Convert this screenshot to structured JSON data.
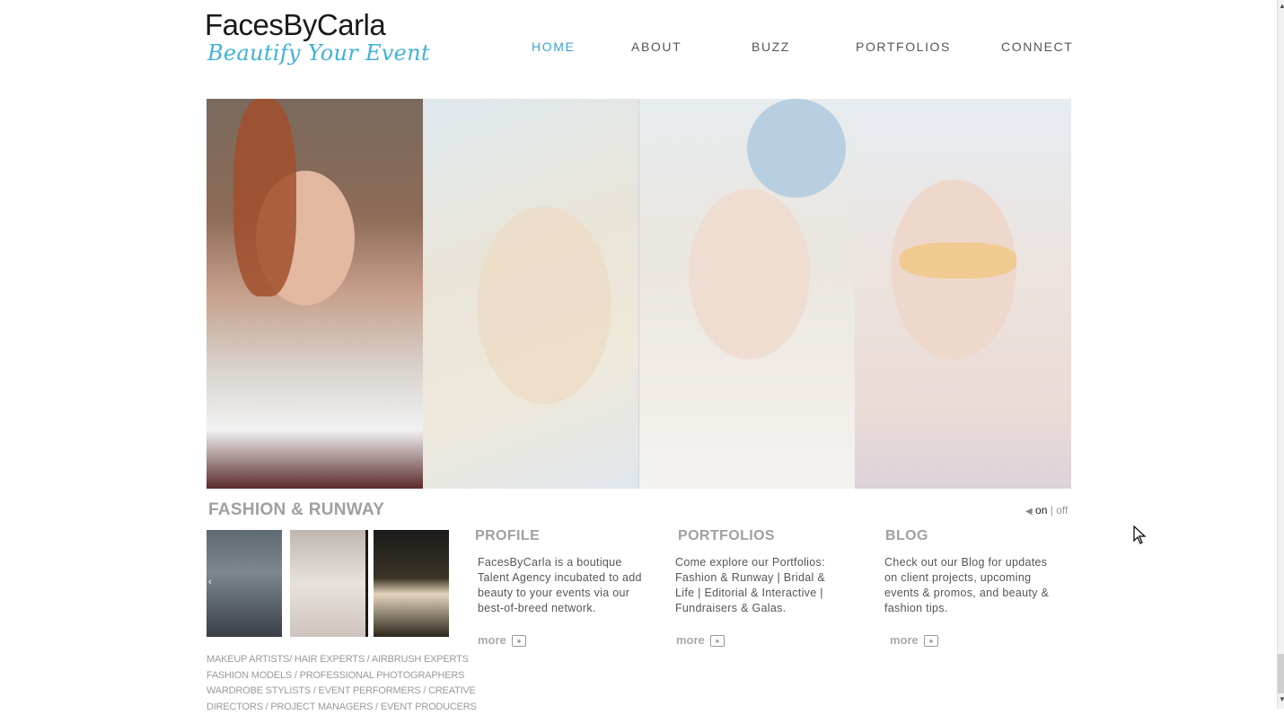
{
  "logo": {
    "title": "FacesByCarla",
    "tagline": "Beautify Your Event"
  },
  "nav": {
    "items": [
      {
        "label": "HOME",
        "active": true
      },
      {
        "label": "ABOUT",
        "active": false
      },
      {
        "label": "BUZZ",
        "active": false
      },
      {
        "label": "PORTFOLIOS",
        "active": false
      },
      {
        "label": "CONNECT",
        "active": false
      }
    ]
  },
  "hero": {
    "section_title": "FASHION & RUNWAY"
  },
  "sound": {
    "on": "on",
    "separator": "|",
    "off": "off"
  },
  "thumbs": {
    "prev": "‹"
  },
  "tags": [
    "MAKEUP ARTISTS/ HAIR EXPERTS / AIRBRUSH EXPERTS",
    "FASHION MODELS / PROFESSIONAL PHOTOGRAPHERS",
    "WARDROBE STYLISTS / EVENT PERFORMERS / CREATIVE",
    "DIRECTORS / PROJECT MANAGERS / EVENT PRODUCERS"
  ],
  "columns": [
    {
      "title": "PROFILE",
      "body": "FacesByCarla is a boutique Talent Agency incubated to add beauty to your events via our best-of-breed network.",
      "more": "more"
    },
    {
      "title": "PORTFOLIOS",
      "body": "Come explore our Portfolios: Fashion & Runway | Bridal & Life | Editorial & Interactive | Fundraisers & Galas.",
      "more": "more"
    },
    {
      "title": "BLOG",
      "body": "Check out our Blog for updates on client projects, upcoming events & promos, and beauty & fashion tips.",
      "more": "more"
    }
  ],
  "colors": {
    "accent": "#3fa3d6",
    "tagline": "#3fb2d6",
    "heading_gray": "#a0a0a0"
  }
}
